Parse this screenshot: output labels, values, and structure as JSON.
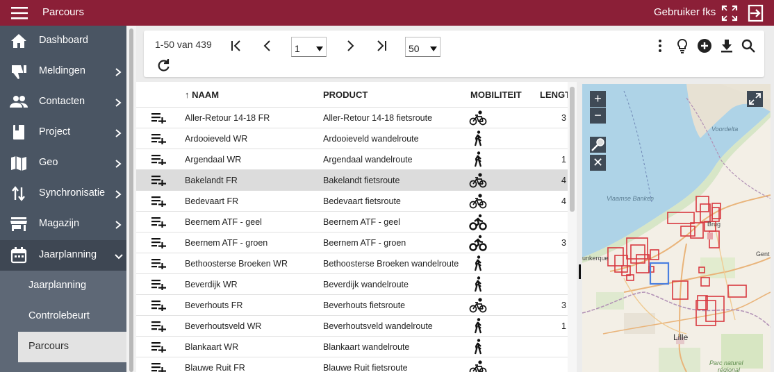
{
  "app": {
    "title": "Parcours",
    "user": "Gebruiker fks"
  },
  "sidebar": {
    "items": [
      {
        "label": "Dashboard",
        "icon": "home-icon"
      },
      {
        "label": "Meldingen",
        "icon": "thumbs-down-icon"
      },
      {
        "label": "Contacten",
        "icon": "people-icon"
      },
      {
        "label": "Project",
        "icon": "book-icon"
      },
      {
        "label": "Geo",
        "icon": "map-icon"
      },
      {
        "label": "Synchronisatie",
        "icon": "sync-arrows-icon"
      },
      {
        "label": "Magazijn",
        "icon": "store-icon"
      },
      {
        "label": "Jaarplanning",
        "icon": "calendar-icon"
      }
    ],
    "subitems": [
      {
        "label": "Jaarplanning"
      },
      {
        "label": "Controlebeurt"
      },
      {
        "label": "Parcours"
      }
    ]
  },
  "toolbar": {
    "range_text": "1-50 van 439",
    "page_value": "1",
    "page_size_value": "50"
  },
  "table": {
    "columns": {
      "naam": "↑ NAAM",
      "product": "PRODUCT",
      "mobiliteit": "MOBILITEIT",
      "lengte": "LENGT"
    },
    "rows": [
      {
        "naam": "Aller-Retour 14-18 FR",
        "product": "Aller-Retour 14-18 fietsroute",
        "mobiliteit": "bicycle",
        "lengte": "3"
      },
      {
        "naam": "Ardooieveld WR",
        "product": "Ardooieveld wandelroute",
        "mobiliteit": "walking",
        "lengte": ""
      },
      {
        "naam": "Argendaal WR",
        "product": "Argendaal wandelroute",
        "mobiliteit": "walking",
        "lengte": "1"
      },
      {
        "naam": "Bakelandt FR",
        "product": "Bakelandt fietsroute",
        "mobiliteit": "bicycle",
        "lengte": "4"
      },
      {
        "naam": "Bedevaart FR",
        "product": "Bedevaart fietsroute",
        "mobiliteit": "bicycle",
        "lengte": "4"
      },
      {
        "naam": "Beernem ATF - geel",
        "product": "Beernem ATF - geel",
        "mobiliteit": "mountain-bike",
        "lengte": ""
      },
      {
        "naam": "Beernem ATF - groen",
        "product": "Beernem ATF - groen",
        "mobiliteit": "mountain-bike",
        "lengte": "3"
      },
      {
        "naam": "Bethoosterse Broeken WR",
        "product": "Bethoosterse Broeken wandelroute",
        "mobiliteit": "walking",
        "lengte": ""
      },
      {
        "naam": "Beverdijk WR",
        "product": "Beverdijk wandelroute",
        "mobiliteit": "walking",
        "lengte": ""
      },
      {
        "naam": "Beverhouts FR",
        "product": "Beverhouts fietsroute",
        "mobiliteit": "bicycle",
        "lengte": "3"
      },
      {
        "naam": "Beverhoutsveld WR",
        "product": "Beverhoutsveld wandelroute",
        "mobiliteit": "walking",
        "lengte": "1"
      },
      {
        "naam": "Blankaart WR",
        "product": "Blankaart wandelroute",
        "mobiliteit": "walking",
        "lengte": ""
      },
      {
        "naam": "Blauwe Ruit FR",
        "product": "Blauwe Ruit fietsroute",
        "mobiliteit": "bicycle",
        "lengte": ""
      }
    ]
  },
  "map": {
    "labels": {
      "voordelta": "Voordelta",
      "vlaamse_banken": "Vlaamse Banken",
      "brugge": "Brug",
      "dunkerque": "unkerque",
      "gent": "Gent",
      "lille": "Lille",
      "parc_naturel": "Parc naturel",
      "regional": "régional"
    },
    "controls": {
      "zoom_in": "+",
      "zoom_out": "−",
      "clear": "✕"
    }
  },
  "colors": {
    "topbar": "#8b1f37",
    "sidebar": "#4a5563",
    "submenu": "#5e6876",
    "route_box": "#d8383f",
    "selected_box": "#4a7fe0"
  }
}
